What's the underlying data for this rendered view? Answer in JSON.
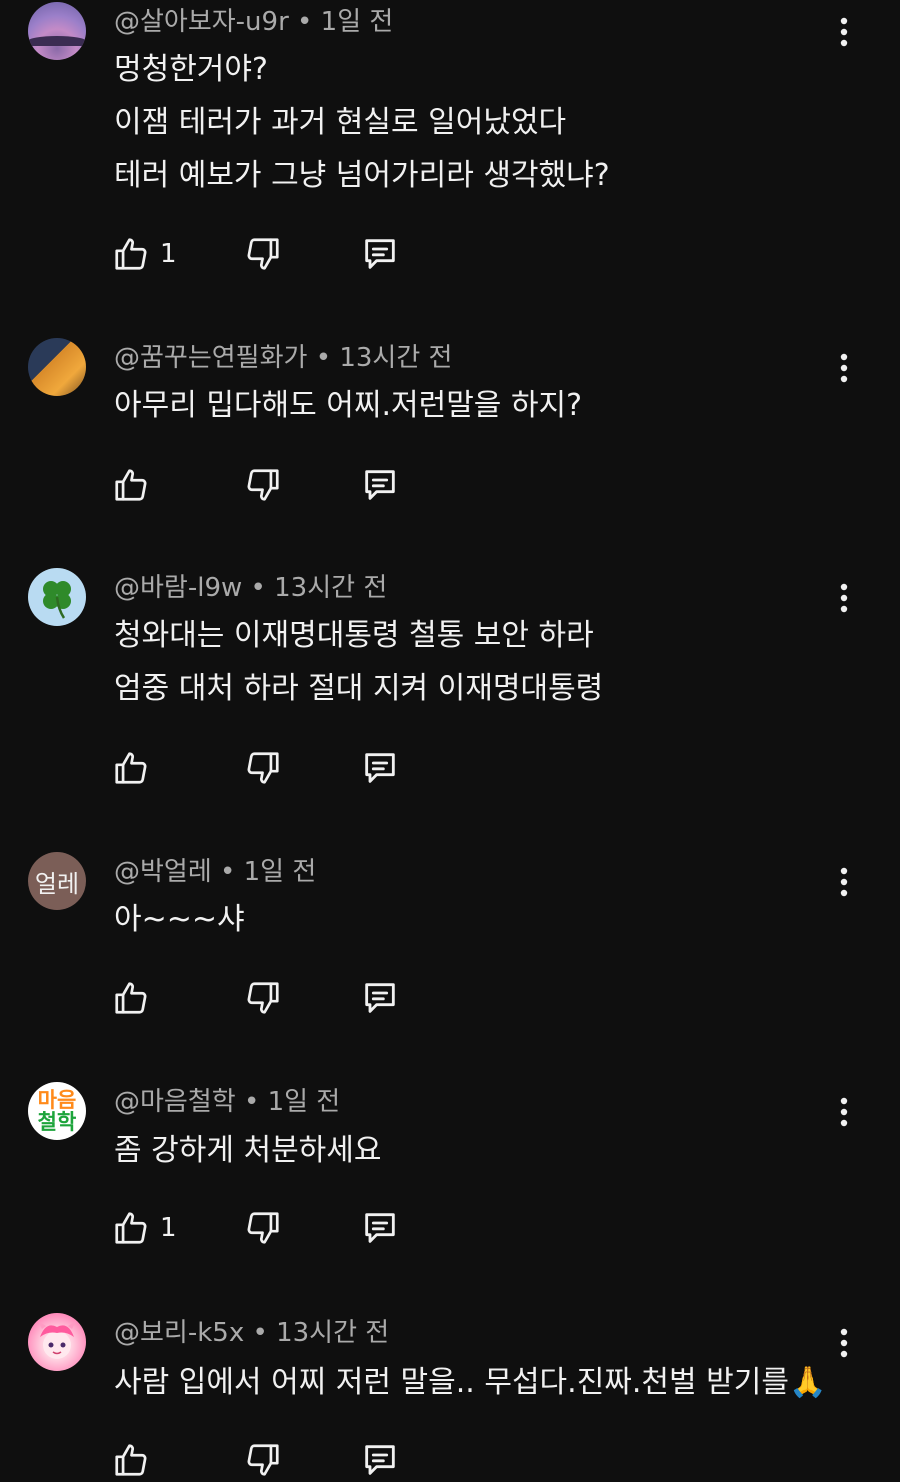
{
  "comments": [
    {
      "author": "@살아보자-u9r",
      "separator": "•",
      "time": "1일 전",
      "avatar": "purple-sky-landscape",
      "lines": [
        "멍청한거야?",
        "이잼 테러가 과거 현실로 일어났었다",
        "테러 예보가 그냥 넘어가리라 생각했냐?"
      ],
      "likes": "1"
    },
    {
      "author": "@꿈꾸는연필화가",
      "separator": "•",
      "time": "13시간 전",
      "avatar": "beer-can-photo",
      "lines": [
        "아무리 밉다해도 어찌.저런말을 하지?"
      ],
      "likes": ""
    },
    {
      "author": "@바람-l9w",
      "separator": "•",
      "time": "13시간 전",
      "avatar": "four-leaf-clover",
      "lines": [
        "청와대는 이재명대통령 철통 보안 하라",
        "엄중 대처 하라  절대 지켜 이재명대통령"
      ],
      "likes": ""
    },
    {
      "author": "@박얼레",
      "separator": "•",
      "time": "1일 전",
      "avatar_text": "얼레",
      "lines": [
        "아~~~샤"
      ],
      "likes": ""
    },
    {
      "author": "@마음철학",
      "separator": "•",
      "time": "1일 전",
      "avatar_text_1": "마음",
      "avatar_text_2": "철학",
      "lines": [
        "좀 강하게 처분하세요"
      ],
      "likes": "1"
    },
    {
      "author": "@보리-k5x",
      "separator": "•",
      "time": "13시간 전",
      "avatar": "anime-character",
      "lines": [
        "사람 입에서 어찌 저런 말을.. 무섭다.진짜.천벌 받기를🙏"
      ],
      "likes": ""
    }
  ],
  "colors": {
    "background": "#0f0f0f",
    "text": "#f1f1f1",
    "meta": "#aaaaaa"
  },
  "icons": {
    "like": "thumbs-up-icon",
    "dislike": "thumbs-down-icon",
    "reply": "reply-comment-icon",
    "menu": "more-vert-icon"
  }
}
